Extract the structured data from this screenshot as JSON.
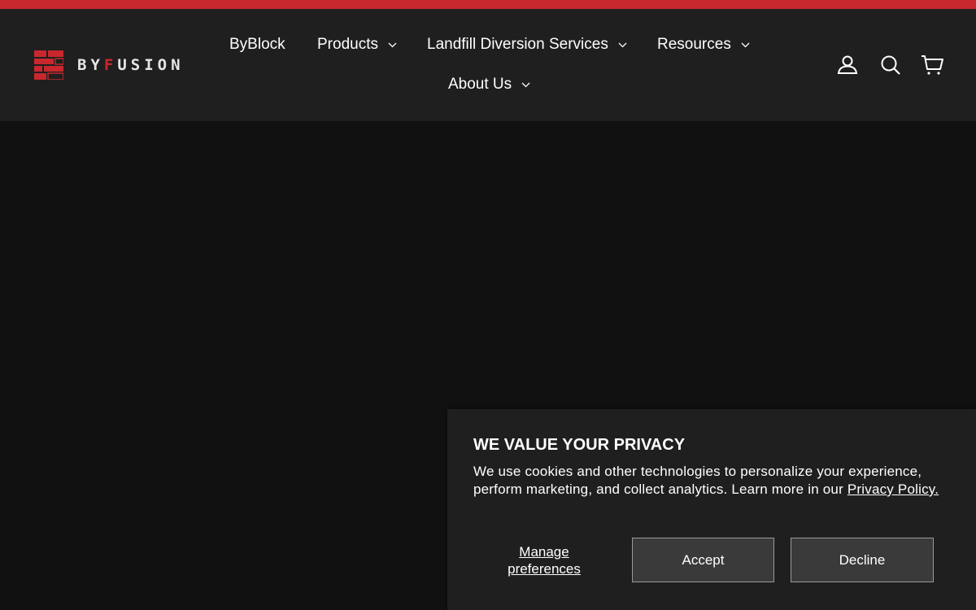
{
  "brand": {
    "name_prefix": "BY",
    "name_accent": "F",
    "name_suffix": "USION",
    "accent_color": "#c8282d"
  },
  "nav": {
    "items": [
      {
        "label": "ByBlock",
        "has_dropdown": false
      },
      {
        "label": "Products",
        "has_dropdown": true
      },
      {
        "label": "Landfill Diversion Services",
        "has_dropdown": true
      },
      {
        "label": "Resources",
        "has_dropdown": true
      },
      {
        "label": "About Us",
        "has_dropdown": true
      }
    ]
  },
  "header_icons": [
    "account-icon",
    "search-icon",
    "cart-icon"
  ],
  "cookie_banner": {
    "title": "WE VALUE YOUR PRIVACY",
    "body": "We use cookies and other technologies to personalize your experience, perform marketing, and collect analytics. Learn more in our ",
    "link_text": "Privacy Policy.",
    "manage_label": "Manage preferences",
    "accept_label": "Accept",
    "decline_label": "Decline"
  }
}
